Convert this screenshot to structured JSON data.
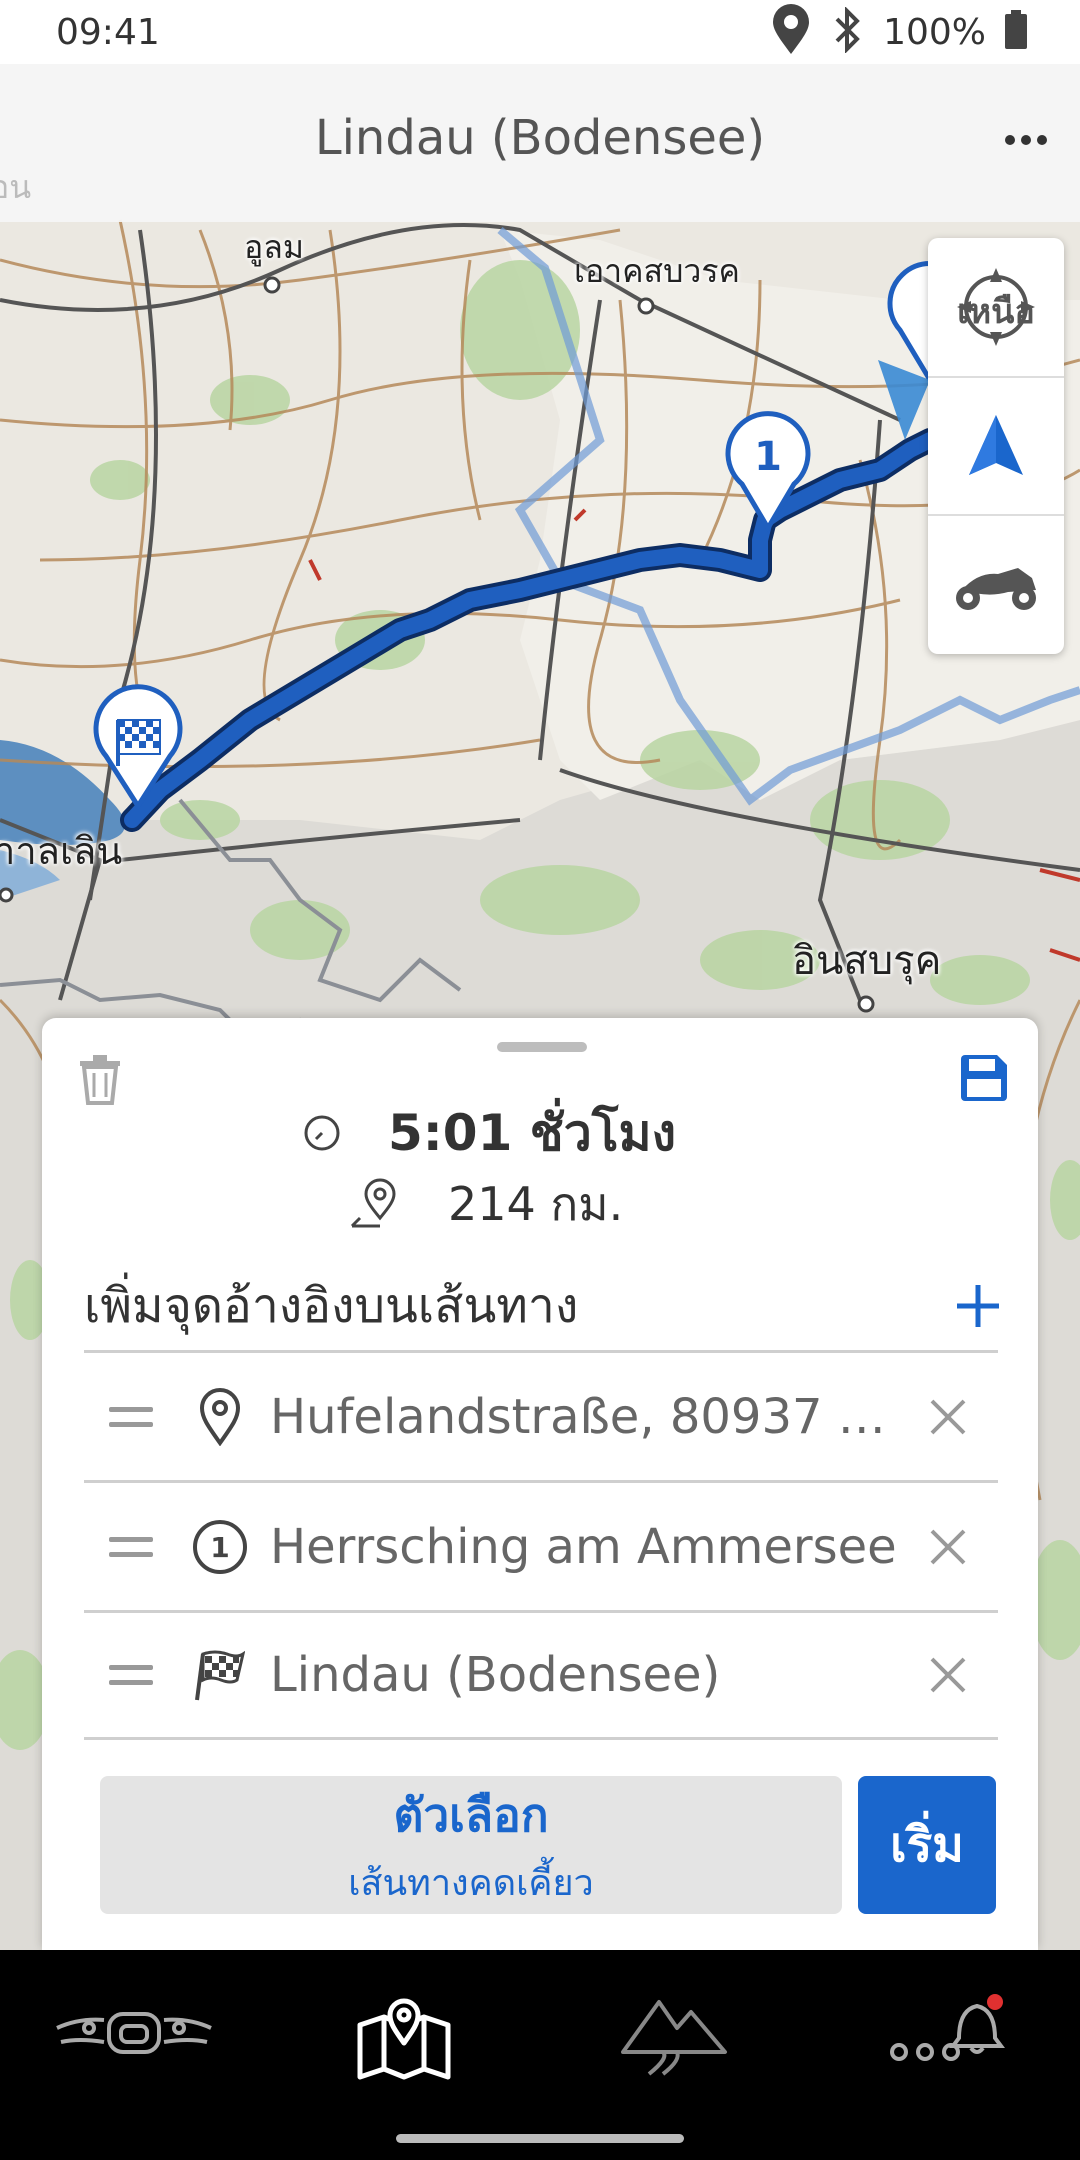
{
  "status_bar": {
    "time": "09:41",
    "battery_text": "100%",
    "icons": [
      "location-icon",
      "bluetooth-icon",
      "battery-icon"
    ]
  },
  "header": {
    "title": "Lindau (Bodensee)",
    "faded_label": "อน",
    "more_icon": "more-dots-icon"
  },
  "map": {
    "labels": {
      "ulm": "อูลม",
      "augsburg": "เอาคสบวรค",
      "bregenz": "าาลเลิน",
      "innsbruck": "อินสบรุค"
    },
    "waypoint_marker_number": "1",
    "colors": {
      "route": "#1f5fbf",
      "route_outline": "#0d2d63",
      "border": "#6f9bd6",
      "lake": "#5d8fc0"
    }
  },
  "map_controls": {
    "compass_label": "เหนือ",
    "icons": [
      "compass-icon",
      "navigation-arrow-icon",
      "motorcycle-icon"
    ]
  },
  "sheet": {
    "duration": "5:01 ชั่วโมง",
    "distance": "214 กม.",
    "add_waypoint_label": "เพิ่มจุดอ้างอิงบนเส้นทาง",
    "waypoints": [
      {
        "label": "Hufelandstraße, 80937 M...",
        "icon": "location-pin-icon"
      },
      {
        "label": "Herrsching am Ammersee",
        "icon": "waypoint-number-icon",
        "number": "1"
      },
      {
        "label": "Lindau (Bodensee)",
        "icon": "checkered-flag-icon"
      }
    ],
    "options_title": "ตัวเลือก",
    "options_subtitle": "เส้นทางคดเคี้ยว",
    "start_label": "เริ่ม",
    "colors": {
      "accent": "#1a66cc"
    }
  },
  "bottom_nav": {
    "items": [
      "motorcycle-dashboard-icon",
      "route-map-icon",
      "mountain-routes-icon",
      "notifications-icon"
    ],
    "active_index": 1
  }
}
